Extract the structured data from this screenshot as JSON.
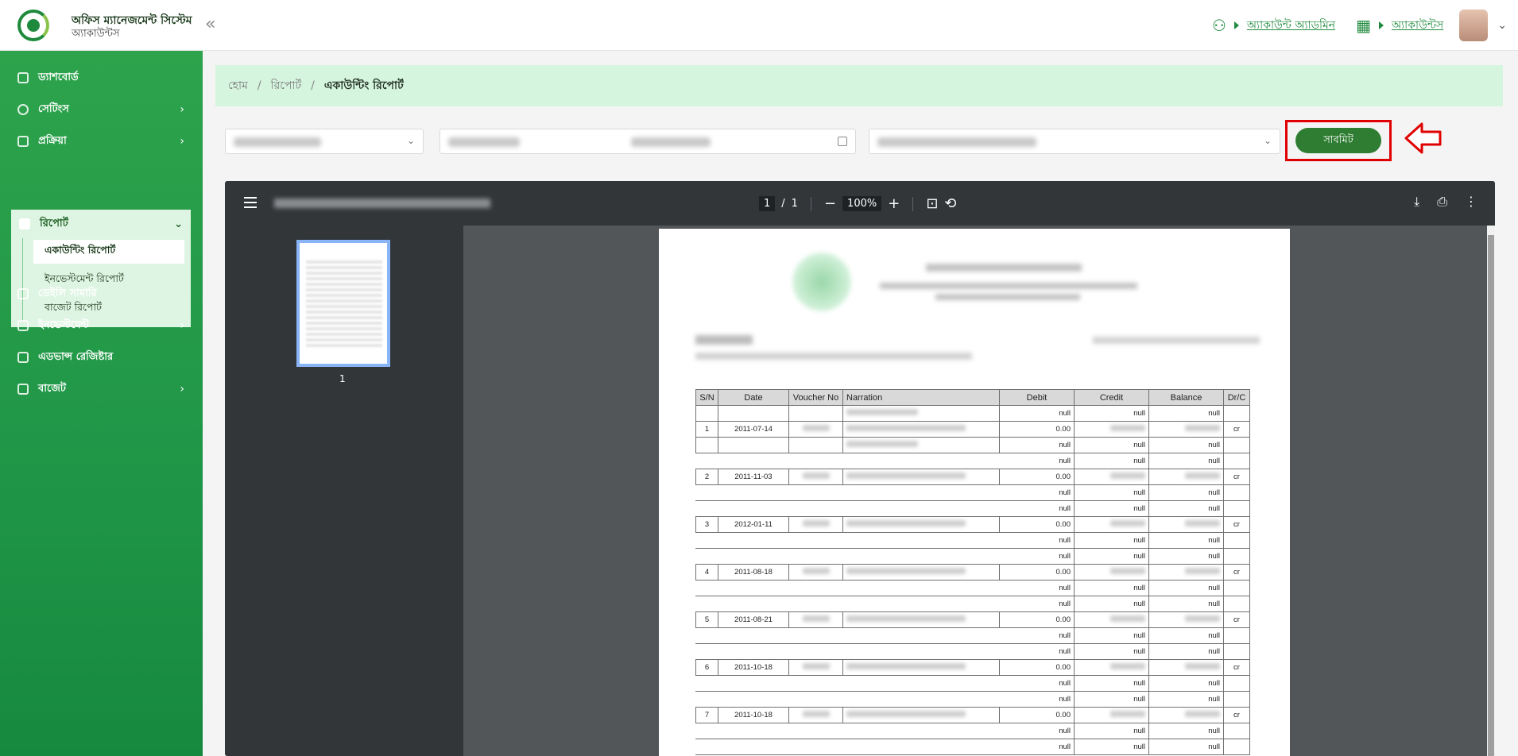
{
  "header": {
    "app_title": "অফিস ম্যানেজমেন্ট সিস্টেম",
    "app_subtitle": "অ্যাকাউন্টস",
    "account_admin": "অ্যাকাউন্ট অ্যাডমিন",
    "accounts_link": "অ্যাকাউন্টস"
  },
  "sidebar": {
    "items": [
      {
        "label": "ড্যাশবোর্ড"
      },
      {
        "label": "সেটিংস"
      },
      {
        "label": "প্রক্রিয়া"
      },
      {
        "label": "রিপোর্ট"
      },
      {
        "label": "ডেইলি সামারি"
      },
      {
        "label": "ইনভেস্টমেন্ট"
      },
      {
        "label": "এডভান্স রেজিষ্টার"
      },
      {
        "label": "বাজেট"
      }
    ],
    "report_sub": [
      {
        "label": "একাউন্টিং রিপোর্ট"
      },
      {
        "label": "ইনভেস্টমেন্ট রিপোর্ট"
      },
      {
        "label": "বাজেট রিপোর্ট"
      }
    ]
  },
  "breadcrumb": {
    "home": "হোম",
    "report": "রিপোর্ট",
    "current": "একাউন্টিং রিপোর্ট"
  },
  "submit_label": "সাবমিট",
  "viewer": {
    "page_current": "1",
    "page_sep": "/",
    "page_total": "1",
    "zoom": "100%",
    "thumb_label": "1"
  },
  "ledger": {
    "headers": [
      "S/N",
      "Date",
      "Voucher No",
      "Narration",
      "Debit",
      "Credit",
      "Balance",
      "Dr/C"
    ],
    "rows": [
      {
        "sn": "",
        "date": "",
        "debit": "null",
        "credit": "null",
        "balance": "null",
        "drc": "",
        "main": false,
        "narr": true
      },
      {
        "sn": "1",
        "date": "2011-07-14",
        "debit": "0.00",
        "credit": "",
        "balance": "",
        "drc": "cr",
        "main": true
      },
      {
        "sn": "",
        "date": "",
        "debit": "null",
        "credit": "null",
        "balance": "null",
        "drc": "",
        "main": false,
        "narr": true
      },
      {
        "sn": "",
        "date": "",
        "debit": "null",
        "credit": "null",
        "balance": "null",
        "drc": "",
        "main": false
      },
      {
        "sn": "2",
        "date": "2011-11-03",
        "debit": "0.00",
        "credit": "",
        "balance": "",
        "drc": "cr",
        "main": true
      },
      {
        "sn": "",
        "date": "",
        "debit": "null",
        "credit": "null",
        "balance": "null",
        "drc": "",
        "main": false
      },
      {
        "sn": "",
        "date": "",
        "debit": "null",
        "credit": "null",
        "balance": "null",
        "drc": "",
        "main": false
      },
      {
        "sn": "3",
        "date": "2012-01-11",
        "debit": "0.00",
        "credit": "",
        "balance": "",
        "drc": "cr",
        "main": true
      },
      {
        "sn": "",
        "date": "",
        "debit": "null",
        "credit": "null",
        "balance": "null",
        "drc": "",
        "main": false
      },
      {
        "sn": "",
        "date": "",
        "debit": "null",
        "credit": "null",
        "balance": "null",
        "drc": "",
        "main": false
      },
      {
        "sn": "4",
        "date": "2011-08-18",
        "debit": "0.00",
        "credit": "",
        "balance": "",
        "drc": "cr",
        "main": true
      },
      {
        "sn": "",
        "date": "",
        "debit": "null",
        "credit": "null",
        "balance": "null",
        "drc": "",
        "main": false
      },
      {
        "sn": "",
        "date": "",
        "debit": "null",
        "credit": "null",
        "balance": "null",
        "drc": "",
        "main": false
      },
      {
        "sn": "5",
        "date": "2011-08-21",
        "debit": "0.00",
        "credit": "",
        "balance": "",
        "drc": "cr",
        "main": true
      },
      {
        "sn": "",
        "date": "",
        "debit": "null",
        "credit": "null",
        "balance": "null",
        "drc": "",
        "main": false
      },
      {
        "sn": "",
        "date": "",
        "debit": "null",
        "credit": "null",
        "balance": "null",
        "drc": "",
        "main": false
      },
      {
        "sn": "6",
        "date": "2011-10-18",
        "debit": "0.00",
        "credit": "",
        "balance": "",
        "drc": "cr",
        "main": true
      },
      {
        "sn": "",
        "date": "",
        "debit": "null",
        "credit": "null",
        "balance": "null",
        "drc": "",
        "main": false
      },
      {
        "sn": "",
        "date": "",
        "debit": "null",
        "credit": "null",
        "balance": "null",
        "drc": "",
        "main": false
      },
      {
        "sn": "7",
        "date": "2011-10-18",
        "debit": "0.00",
        "credit": "",
        "balance": "",
        "drc": "cr",
        "main": true
      },
      {
        "sn": "",
        "date": "",
        "debit": "null",
        "credit": "null",
        "balance": "null",
        "drc": "",
        "main": false
      },
      {
        "sn": "",
        "date": "",
        "debit": "null",
        "credit": "null",
        "balance": "null",
        "drc": "",
        "main": false
      }
    ]
  },
  "colors": {
    "brand_green": "#1f8a3e",
    "highlight_red": "#e00000",
    "submit_green": "#2f7d32"
  }
}
